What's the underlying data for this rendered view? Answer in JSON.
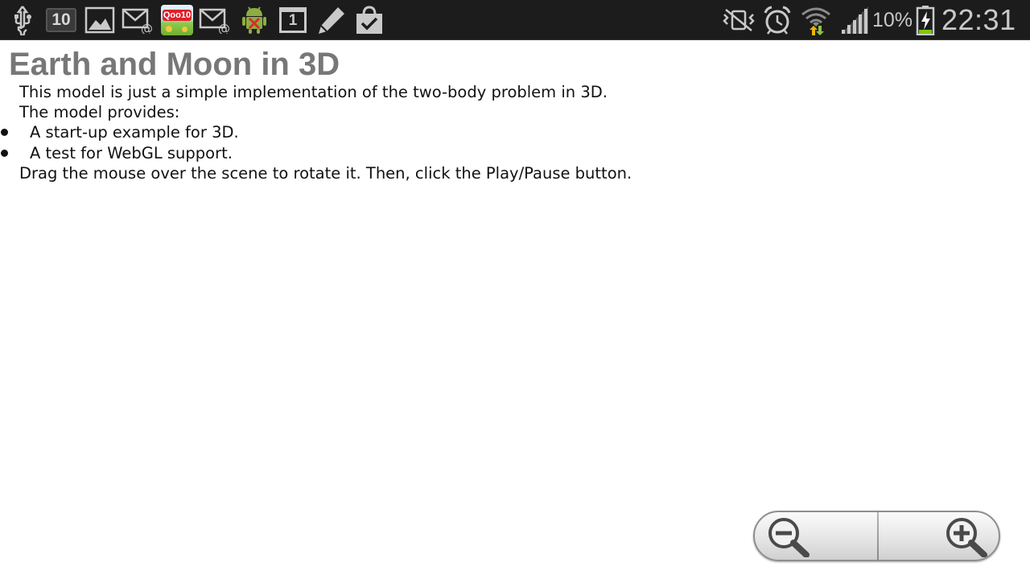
{
  "status_bar": {
    "icons": [
      "usb-icon",
      "notification-count-icon",
      "gallery-icon",
      "email-icon",
      "qoo10-app-icon",
      "email-icon",
      "android-debug-icon",
      "calendar-icon",
      "pencil-icon",
      "shopping-bag-icon",
      "vibrate-icon",
      "alarm-icon",
      "wifi-icon",
      "cell-signal-icon",
      "battery-charging-icon"
    ],
    "notification_count": "10",
    "qoo10_label": "Qoo10",
    "calendar_day": "1",
    "signal_percent": "10%",
    "clock": "22:31",
    "colors": {
      "background": "#1c1c1c",
      "icon": "#c9c9c9",
      "wifi_up_arrow": "#f0b400",
      "wifi_down_arrow": "#8cc63f",
      "battery_level": "#7ec800"
    }
  },
  "page": {
    "title": "Earth and Moon in 3D",
    "intro": "This model is just a simple implementation of the two-body problem in 3D.",
    "provides": "The model provides:",
    "features": [
      "A start-up example for 3D.",
      "A test for WebGL support."
    ],
    "instructions": "Drag the mouse over the scene to rotate it. Then, click the Play/Pause button."
  },
  "zoom": {
    "out_icon": "zoom-out-icon",
    "in_icon": "zoom-in-icon"
  }
}
